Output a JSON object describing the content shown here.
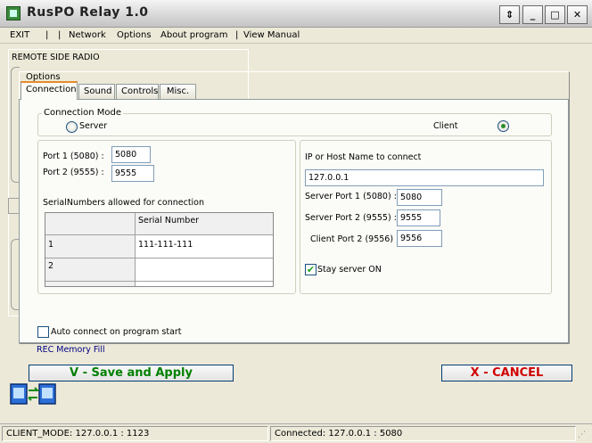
{
  "window": {
    "title": "RusPO  Relay 1.0",
    "controls": [
      "⇕",
      "_",
      "□",
      "✕"
    ]
  },
  "menu": {
    "items": [
      "EXIT",
      "|",
      "|",
      "Network",
      "Options",
      "About program",
      "|",
      "View Manual"
    ]
  },
  "background_panel": {
    "title": "REMOTE SIDE RADIO",
    "memory_link": "REC Memory Fill"
  },
  "options": {
    "title": "Options",
    "tabs": [
      "Connection",
      "Sound",
      "Controls",
      "Misc."
    ],
    "active_tab": "Connection",
    "connection_mode": {
      "label": "Connection Mode",
      "server_label": "Server",
      "client_label": "Client",
      "selected": "Client"
    },
    "server": {
      "port1_label": "Port 1 (5080) :",
      "port1_value": "5080",
      "port2_label": "Port 2 (9555) :",
      "port2_value": "9555",
      "serials_label": "SerialNumbers allowed for connection",
      "table": {
        "header": "Serial Number",
        "rows": [
          {
            "index": "1",
            "serial": "111-111-111"
          },
          {
            "index": "2",
            "serial": ""
          }
        ]
      }
    },
    "client": {
      "host_label": "IP or Host Name to connect",
      "host_value": "127.0.0.1",
      "server_port1_label": "Server Port 1 (5080) :",
      "server_port1_value": "5080",
      "server_port2_label": "Server Port 2 (9555) :",
      "server_port2_value": "9555",
      "client_port2_label": "Client Port 2 (9556) :",
      "client_port2_value": "9556",
      "stay_on_label": "Stay server ON",
      "stay_on_checked": true
    },
    "auto_connect_label": "Auto connect on program start",
    "auto_connect_checked": false
  },
  "buttons": {
    "save": "V - Save and Apply",
    "cancel": "X - CANCEL"
  },
  "colors": {
    "save_text": "#008000",
    "cancel_text": "#d00000",
    "link": "#000080",
    "tab_highlight": "#e68b2c"
  },
  "status": {
    "left": "CLIENT_MODE: 127.0.0.1 : 1123",
    "right": "Connected: 127.0.0.1 : 5080"
  }
}
